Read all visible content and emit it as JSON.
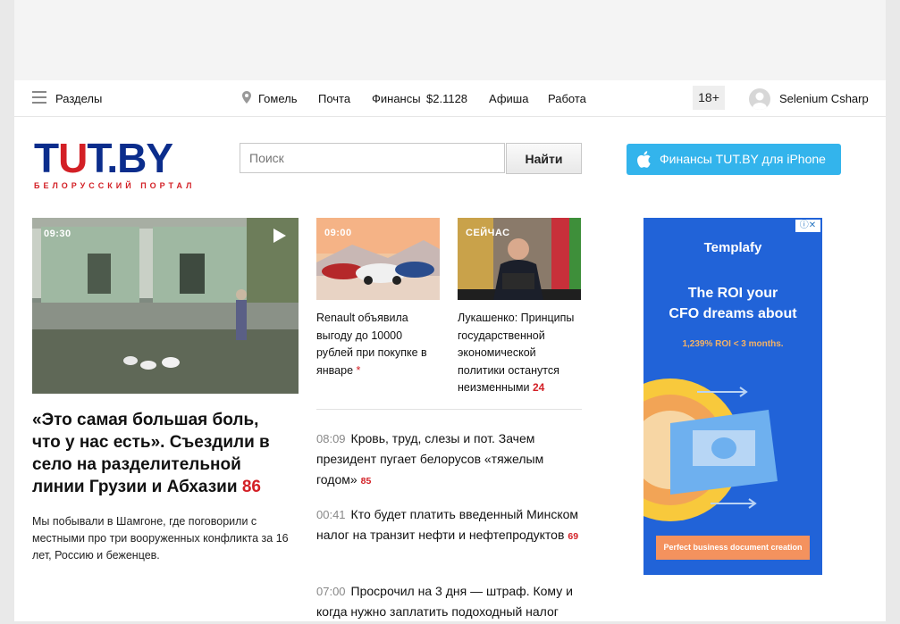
{
  "nav": {
    "sections": "Разделы",
    "city": "Гомель",
    "mail": "Почта",
    "finance": "Финансы",
    "rate": "$2.1128",
    "afisha": "Афиша",
    "work": "Работа",
    "age": "18+",
    "user": "Selenium Csharp"
  },
  "logo": {
    "main_a": "T",
    "main_u": "U",
    "main_b": "T.BY",
    "sub": "БЕЛОРУССКИЙ ПОРТАЛ"
  },
  "search": {
    "placeholder": "Поиск",
    "button": "Найти"
  },
  "app_button": {
    "label": "Финансы TUT.BY для iPhone"
  },
  "main_story": {
    "time": "09:30",
    "title": "«Это самая большая боль, что у нас есть». Съездили в село на разделительной линии Грузии и Абхазии",
    "count": "86",
    "lead": "Мы побывали в Шамгоне, где поговорили с местными про три вооруженных конфликта за 16 лет, Россию и беженцев."
  },
  "story2": {
    "time": "09:00",
    "title": "Renault объявила выгоду до 10000 рублей при покупке в январе",
    "mark": "*"
  },
  "story3": {
    "time": "СЕЙЧАС",
    "title": "Лукашенко: Принципы государственной экономической политики останутся неизменными",
    "count": "24"
  },
  "news": [
    {
      "time": "08:09",
      "title": "Кровь, труд, слезы и пот. Зачем президент пугает белорусов «тяжелым годом»",
      "count": "85"
    },
    {
      "time": "00:41",
      "title": "Кто будет платить введенный Минском налог на транзит нефти и нефтепродуктов",
      "count": "69"
    },
    {
      "time": "07:00",
      "title": "Просрочил на 3 дня — штраф. Кому и когда нужно заплатить подоходный налог",
      "count": ""
    }
  ],
  "ad": {
    "brand": "Templafy",
    "headline1": "The ROI your",
    "headline2": "CFO dreams about",
    "sub": "1,239% ROI < 3 months.",
    "cta": "Perfect business document creation"
  }
}
